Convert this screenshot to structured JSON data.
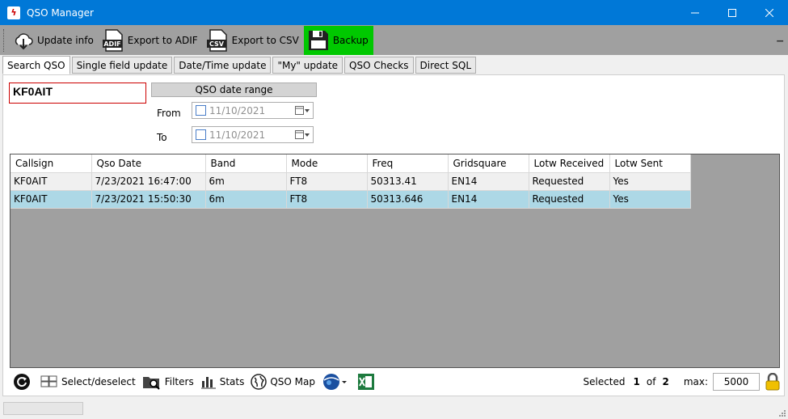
{
  "window": {
    "title": "QSO Manager"
  },
  "toolbar": {
    "update_info": "Update info",
    "export_adif": "Export to ADIF",
    "export_csv": "Export to CSV",
    "backup": "Backup",
    "adif_badge": "ADIF",
    "csv_badge": "CSV"
  },
  "tabs": [
    "Search QSO",
    "Single field update",
    "Date/Time update",
    "\"My\" update",
    "QSO Checks",
    "Direct SQL"
  ],
  "search": {
    "value": "KF0AIT",
    "range_button": "QSO date range",
    "from_label": "From",
    "to_label": "To",
    "from_date": "11/10/2021",
    "to_date": "11/10/2021"
  },
  "grid": {
    "columns": [
      "Callsign",
      "Qso Date",
      "Band",
      "Mode",
      "Freq",
      "Gridsquare",
      "Lotw Received",
      "Lotw Sent"
    ],
    "rows": [
      [
        "KF0AIT",
        "7/23/2021 16:47:00",
        "6m",
        "FT8",
        "50313.41",
        "EN14",
        "Requested",
        "Yes"
      ],
      [
        "KF0AIT",
        "7/23/2021 15:50:30",
        "6m",
        "FT8",
        "50313.646",
        "EN14",
        "Requested",
        "Yes"
      ]
    ]
  },
  "bottom": {
    "select_deselect": "Select/deselect",
    "filters": "Filters",
    "stats": "Stats",
    "qso_map": "QSO Map",
    "selected_label": "Selected",
    "selected_count": "1",
    "of_label": "of",
    "total_count": "2",
    "max_label": "max:",
    "max_value": "5000"
  },
  "colors": {
    "titlebar": "#0078d7",
    "toolbar": "#a0a0a0",
    "backup_active": "#00c800",
    "selected_row": "#add8e6"
  }
}
